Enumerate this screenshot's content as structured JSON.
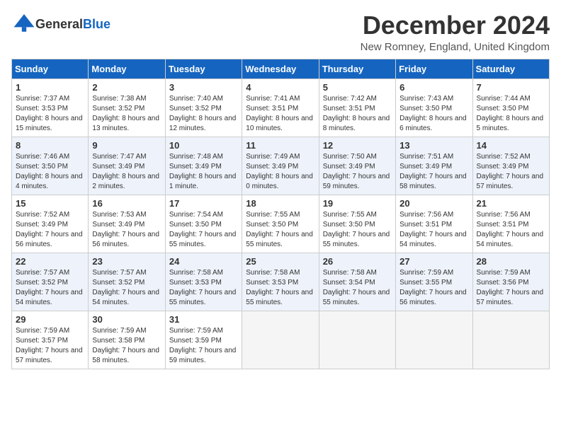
{
  "header": {
    "logo_general": "General",
    "logo_blue": "Blue",
    "title": "December 2024",
    "subtitle": "New Romney, England, United Kingdom"
  },
  "columns": [
    "Sunday",
    "Monday",
    "Tuesday",
    "Wednesday",
    "Thursday",
    "Friday",
    "Saturday"
  ],
  "weeks": [
    [
      {
        "day": "1",
        "rise": "7:37 AM",
        "set": "3:53 PM",
        "daylight": "8 hours and 15 minutes."
      },
      {
        "day": "2",
        "rise": "7:38 AM",
        "set": "3:52 PM",
        "daylight": "8 hours and 13 minutes."
      },
      {
        "day": "3",
        "rise": "7:40 AM",
        "set": "3:52 PM",
        "daylight": "8 hours and 12 minutes."
      },
      {
        "day": "4",
        "rise": "7:41 AM",
        "set": "3:51 PM",
        "daylight": "8 hours and 10 minutes."
      },
      {
        "day": "5",
        "rise": "7:42 AM",
        "set": "3:51 PM",
        "daylight": "8 hours and 8 minutes."
      },
      {
        "day": "6",
        "rise": "7:43 AM",
        "set": "3:50 PM",
        "daylight": "8 hours and 6 minutes."
      },
      {
        "day": "7",
        "rise": "7:44 AM",
        "set": "3:50 PM",
        "daylight": "8 hours and 5 minutes."
      }
    ],
    [
      {
        "day": "8",
        "rise": "7:46 AM",
        "set": "3:50 PM",
        "daylight": "8 hours and 4 minutes."
      },
      {
        "day": "9",
        "rise": "7:47 AM",
        "set": "3:49 PM",
        "daylight": "8 hours and 2 minutes."
      },
      {
        "day": "10",
        "rise": "7:48 AM",
        "set": "3:49 PM",
        "daylight": "8 hours and 1 minute."
      },
      {
        "day": "11",
        "rise": "7:49 AM",
        "set": "3:49 PM",
        "daylight": "8 hours and 0 minutes."
      },
      {
        "day": "12",
        "rise": "7:50 AM",
        "set": "3:49 PM",
        "daylight": "7 hours and 59 minutes."
      },
      {
        "day": "13",
        "rise": "7:51 AM",
        "set": "3:49 PM",
        "daylight": "7 hours and 58 minutes."
      },
      {
        "day": "14",
        "rise": "7:52 AM",
        "set": "3:49 PM",
        "daylight": "7 hours and 57 minutes."
      }
    ],
    [
      {
        "day": "15",
        "rise": "7:52 AM",
        "set": "3:49 PM",
        "daylight": "7 hours and 56 minutes."
      },
      {
        "day": "16",
        "rise": "7:53 AM",
        "set": "3:49 PM",
        "daylight": "7 hours and 56 minutes."
      },
      {
        "day": "17",
        "rise": "7:54 AM",
        "set": "3:50 PM",
        "daylight": "7 hours and 55 minutes."
      },
      {
        "day": "18",
        "rise": "7:55 AM",
        "set": "3:50 PM",
        "daylight": "7 hours and 55 minutes."
      },
      {
        "day": "19",
        "rise": "7:55 AM",
        "set": "3:50 PM",
        "daylight": "7 hours and 55 minutes."
      },
      {
        "day": "20",
        "rise": "7:56 AM",
        "set": "3:51 PM",
        "daylight": "7 hours and 54 minutes."
      },
      {
        "day": "21",
        "rise": "7:56 AM",
        "set": "3:51 PM",
        "daylight": "7 hours and 54 minutes."
      }
    ],
    [
      {
        "day": "22",
        "rise": "7:57 AM",
        "set": "3:52 PM",
        "daylight": "7 hours and 54 minutes."
      },
      {
        "day": "23",
        "rise": "7:57 AM",
        "set": "3:52 PM",
        "daylight": "7 hours and 54 minutes."
      },
      {
        "day": "24",
        "rise": "7:58 AM",
        "set": "3:53 PM",
        "daylight": "7 hours and 55 minutes."
      },
      {
        "day": "25",
        "rise": "7:58 AM",
        "set": "3:53 PM",
        "daylight": "7 hours and 55 minutes."
      },
      {
        "day": "26",
        "rise": "7:58 AM",
        "set": "3:54 PM",
        "daylight": "7 hours and 55 minutes."
      },
      {
        "day": "27",
        "rise": "7:59 AM",
        "set": "3:55 PM",
        "daylight": "7 hours and 56 minutes."
      },
      {
        "day": "28",
        "rise": "7:59 AM",
        "set": "3:56 PM",
        "daylight": "7 hours and 57 minutes."
      }
    ],
    [
      {
        "day": "29",
        "rise": "7:59 AM",
        "set": "3:57 PM",
        "daylight": "7 hours and 57 minutes."
      },
      {
        "day": "30",
        "rise": "7:59 AM",
        "set": "3:58 PM",
        "daylight": "7 hours and 58 minutes."
      },
      {
        "day": "31",
        "rise": "7:59 AM",
        "set": "3:59 PM",
        "daylight": "7 hours and 59 minutes."
      },
      null,
      null,
      null,
      null
    ]
  ]
}
